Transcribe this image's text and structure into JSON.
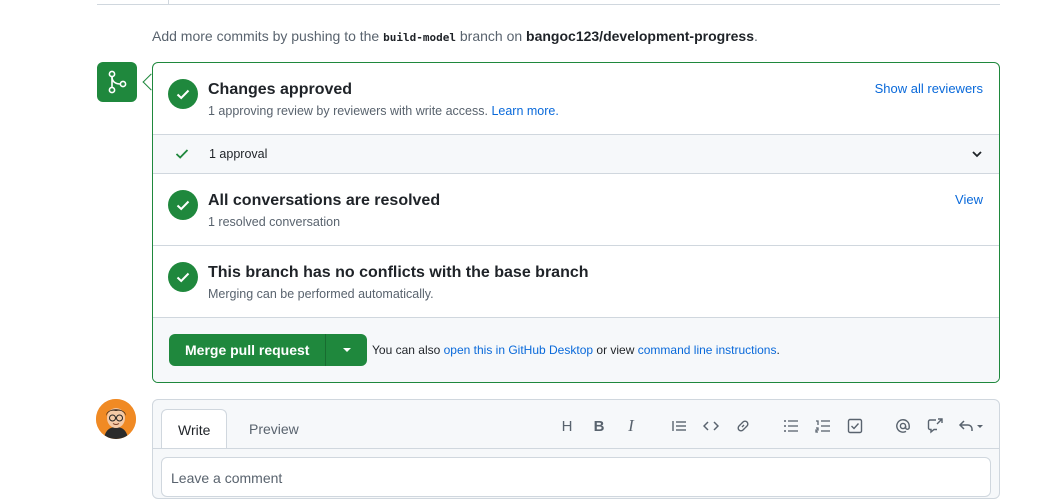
{
  "push_note": {
    "prefix": "Add more commits by pushing to the",
    "branch": "build-model",
    "middle": "branch on",
    "repo": "bangoc123/development-progress",
    "suffix": "."
  },
  "merge_box": {
    "approved": {
      "title": "Changes approved",
      "subtitle": "1 approving review by reviewers with write access.",
      "learn_more": "Learn more.",
      "link": "Show all reviewers"
    },
    "approval_row": {
      "label": "1 approval"
    },
    "conversations": {
      "title": "All conversations are resolved",
      "subtitle": "1 resolved conversation",
      "link": "View"
    },
    "conflicts": {
      "title": "This branch has no conflicts with the base branch",
      "subtitle": "Merging can be performed automatically."
    },
    "merge": {
      "button": "Merge pull request",
      "help_prefix": "You can also",
      "desktop_link": "open this in GitHub Desktop",
      "help_middle": "or view",
      "cli_link": "command line instructions",
      "help_suffix": "."
    }
  },
  "comment": {
    "tab_write": "Write",
    "tab_preview": "Preview",
    "placeholder": "Leave a comment",
    "toolbar": {
      "heading": "H",
      "bold": "B",
      "italic": "I"
    }
  },
  "colors": {
    "success": "#1f883d",
    "link": "#0969da",
    "border": "#d0d7de",
    "avatar_bg": "#f08a24"
  },
  "icons": {
    "badge": "git-merge-icon",
    "status": "check-circle-icon",
    "toolbar": [
      "heading-icon",
      "bold-icon",
      "italic-icon",
      "quote-icon",
      "code-icon",
      "link-icon",
      "unordered-list-icon",
      "ordered-list-icon",
      "task-list-icon",
      "mention-icon",
      "cross-reference-icon",
      "saved-replies-icon"
    ]
  }
}
